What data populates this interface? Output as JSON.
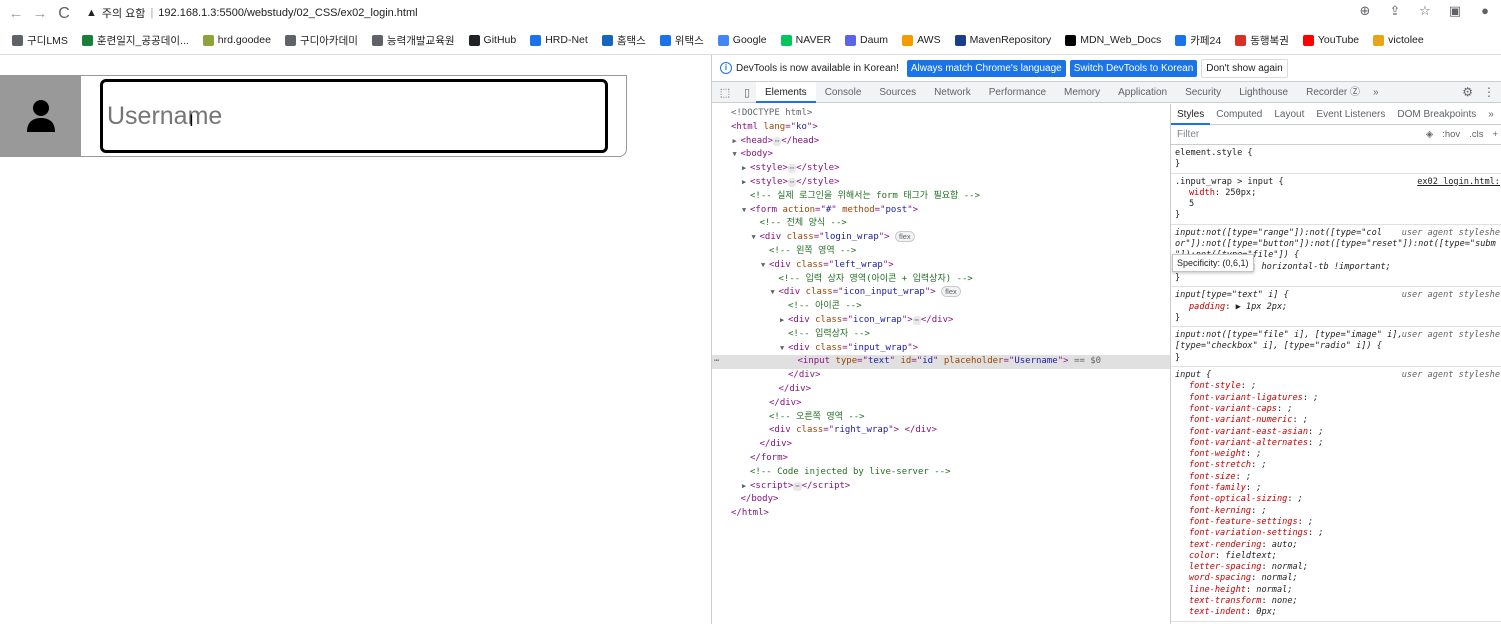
{
  "browser": {
    "back_icon": "←",
    "forward_icon": "→",
    "reload_icon": "C",
    "security_label": "주의 요함",
    "url": "192.168.1.3:5500/webstudy/02_CSS/ex02_login.html",
    "actions": [
      "zoom-icon",
      "share-icon",
      "star-icon",
      "sidepanel-icon",
      "profile-icon"
    ]
  },
  "bookmarks": [
    {
      "label": "구디LMS",
      "color": "#5f6368"
    },
    {
      "label": "훈련일지_공공데이...",
      "color": "#188038"
    },
    {
      "label": "hrd.goodee",
      "color": "#8aa33a"
    },
    {
      "label": "구디아카데미",
      "color": "#5f6368"
    },
    {
      "label": "능력개발교육원",
      "color": "#5f6368"
    },
    {
      "label": "GitHub",
      "color": "#202124"
    },
    {
      "label": "HRD-Net",
      "color": "#1a73e8"
    },
    {
      "label": "홈택스",
      "color": "#1565c0"
    },
    {
      "label": "위택스",
      "color": "#1a73e8"
    },
    {
      "label": "Google",
      "color": "#4285f4"
    },
    {
      "label": "NAVER",
      "color": "#03c75a"
    },
    {
      "label": "Daum",
      "color": "#5b63e6"
    },
    {
      "label": "AWS",
      "color": "#f59b00"
    },
    {
      "label": "MavenRepository",
      "color": "#1a3e8c"
    },
    {
      "label": "MDN_Web_Docs",
      "color": "#000000"
    },
    {
      "label": "카페24",
      "color": "#1a73e8"
    },
    {
      "label": "동행복권",
      "color": "#d93025"
    },
    {
      "label": "YouTube",
      "color": "#ff0000"
    },
    {
      "label": "victolee",
      "color": "#e8a317"
    }
  ],
  "page": {
    "username_placeholder": "Username",
    "user_icon": "person-icon"
  },
  "devtools": {
    "info_message": "DevTools is now available in Korean!",
    "btn_match": "Always match Chrome's language",
    "btn_switch": "Switch DevTools to Korean",
    "btn_dismiss": "Don't show again",
    "tabs": [
      "Elements",
      "Console",
      "Sources",
      "Network",
      "Performance",
      "Memory",
      "Application",
      "Security",
      "Lighthouse",
      "Recorder Ⓩ"
    ],
    "more_tabs": "»",
    "styles_tabs": [
      "Styles",
      "Computed",
      "Layout",
      "Event Listeners",
      "DOM Breakpoints",
      "»"
    ],
    "filter_placeholder": "Filter",
    "filter_tools": [
      ":hov",
      ".cls",
      "+"
    ],
    "tooltip": "Specificity: (0,6,1)",
    "dom_lines": [
      {
        "indent": 0,
        "tri": "",
        "html": "doctype"
      },
      {
        "indent": 0,
        "tri": "",
        "html": "html_open"
      },
      {
        "indent": 1,
        "tri": "▶",
        "html": "head"
      },
      {
        "indent": 1,
        "tri": "▼",
        "html": "body_open"
      },
      {
        "indent": 2,
        "tri": "▶",
        "html": "style1"
      },
      {
        "indent": 2,
        "tri": "▶",
        "html": "style2"
      },
      {
        "indent": 2,
        "tri": "",
        "html": "cmt_form"
      },
      {
        "indent": 2,
        "tri": "▼",
        "html": "form_open"
      },
      {
        "indent": 3,
        "tri": "",
        "html": "cmt_all"
      },
      {
        "indent": 3,
        "tri": "▼",
        "html": "login_wrap"
      },
      {
        "indent": 4,
        "tri": "",
        "html": "cmt_left"
      },
      {
        "indent": 4,
        "tri": "▼",
        "html": "left_wrap"
      },
      {
        "indent": 5,
        "tri": "",
        "html": "cmt_input_area"
      },
      {
        "indent": 5,
        "tri": "▼",
        "html": "icon_input_wrap"
      },
      {
        "indent": 6,
        "tri": "",
        "html": "cmt_icon"
      },
      {
        "indent": 6,
        "tri": "▶",
        "html": "icon_wrap"
      },
      {
        "indent": 6,
        "tri": "",
        "html": "cmt_inputbox"
      },
      {
        "indent": 6,
        "tri": "▼",
        "html": "input_wrap"
      },
      {
        "indent": 7,
        "tri": "",
        "html": "input_el",
        "selected": true
      },
      {
        "indent": 6,
        "tri": "",
        "html": "div_close"
      },
      {
        "indent": 5,
        "tri": "",
        "html": "div_close"
      },
      {
        "indent": 4,
        "tri": "",
        "html": "div_close"
      },
      {
        "indent": 4,
        "tri": "",
        "html": "cmt_right"
      },
      {
        "indent": 4,
        "tri": "",
        "html": "right_wrap"
      },
      {
        "indent": 3,
        "tri": "",
        "html": "div_close"
      },
      {
        "indent": 2,
        "tri": "",
        "html": "form_close"
      },
      {
        "indent": 2,
        "tri": "",
        "html": "cmt_injected"
      },
      {
        "indent": 2,
        "tri": "▶",
        "html": "script"
      },
      {
        "indent": 1,
        "tri": "",
        "html": "body_close"
      },
      {
        "indent": 0,
        "tri": "",
        "html": "html_close"
      }
    ],
    "dom_text": {
      "doctype": "<!DOCTYPE html>",
      "html_open": [
        "<html ",
        "lang",
        "=\"",
        "ko",
        "\">"
      ],
      "comment_form": "<!-- 실제 로그인을 위해서는 form 태그가 필요함 -->",
      "comment_all": "<!-- 전체 양식 -->",
      "comment_left": "<!-- 왼쪽 영역 -->",
      "comment_input_area": "<!-- 입력 상자 영역(아이콘 + 입력상자) -->",
      "comment_icon": "<!-- 아이콘 -->",
      "comment_inputbox": "<!-- 입력상자 -->",
      "comment_right": "<!-- 오른쪽 영역 -->",
      "comment_injected": "<!-- Code injected by live-server -->",
      "flex_badge": "flex",
      "eq_sign": "== $0",
      "input_type": "text",
      "input_id": "id",
      "input_placeholder": "Username",
      "form_action": "#",
      "form_method": "post"
    },
    "rules": [
      {
        "selector": "element.style {",
        "source": "",
        "props": [],
        "close": "}",
        "ua": false
      },
      {
        "selector": ".input_wrap > input {",
        "source": "ex02_login.html:",
        "props": [
          [
            "width",
            "250px;"
          ],
          [
            "",
            "5"
          ]
        ],
        "close": "}",
        "ua": false,
        "link": true
      },
      {
        "selector": "input:not([type=\"range\"]):not([type=\"col or\"]):not([type=\"button\"]):not([type=\"reset\"]):not([type=\"subm \"]):not([type=\"file\"]) {",
        "source": "user agent styleshe",
        "props": [
          [
            "writing-mode",
            "horizontal-tb !important;"
          ]
        ],
        "close": "}",
        "ua": true
      },
      {
        "selector": "input[type=\"text\" i] {",
        "source": "user agent styleshe",
        "props": [
          [
            "padding",
            "▶ 1px 2px;"
          ]
        ],
        "close": "}",
        "ua": true
      },
      {
        "selector": "input:not([type=\"file\" i], [type=\"image\" i], [type=\"checkbox\" i], [type=\"radio\" i]) {",
        "source": "user agent styleshe",
        "props": [],
        "close": "}",
        "ua": true
      },
      {
        "selector": "input {",
        "source": "user agent styleshe",
        "props": [
          [
            "font-style",
            ";"
          ],
          [
            "font-variant-ligatures",
            ";"
          ],
          [
            "font-variant-caps",
            ";"
          ],
          [
            "font-variant-numeric",
            ";"
          ],
          [
            "font-variant-east-asian",
            ";"
          ],
          [
            "font-variant-alternates",
            ";"
          ],
          [
            "font-weight",
            ";"
          ],
          [
            "font-stretch",
            ";"
          ],
          [
            "font-size",
            ";"
          ],
          [
            "font-family",
            ";"
          ],
          [
            "font-optical-sizing",
            ";"
          ],
          [
            "font-kerning",
            ";"
          ],
          [
            "font-feature-settings",
            ";"
          ],
          [
            "font-variation-settings",
            ";"
          ],
          [
            "text-rendering",
            "auto;"
          ],
          [
            "color",
            "fieldtext;"
          ],
          [
            "letter-spacing",
            "normal;"
          ],
          [
            "word-spacing",
            "normal;"
          ],
          [
            "line-height",
            "normal;"
          ],
          [
            "text-transform",
            "none;"
          ],
          [
            "text-indent",
            "0px;"
          ]
        ],
        "close": "",
        "ua": true
      }
    ]
  }
}
